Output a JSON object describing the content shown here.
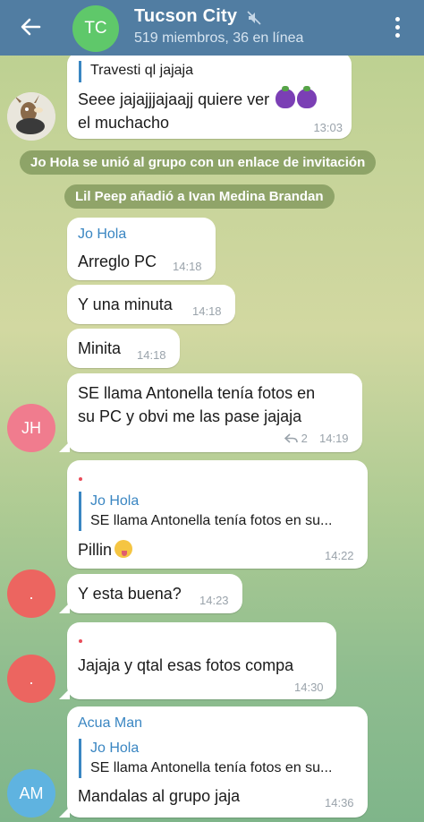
{
  "header": {
    "title": "Tucson City",
    "subtitle": "519 miembros, 36 en línea",
    "avatar_initials": "TC",
    "avatar_color": "#5fc86a",
    "bar_color": "#517da2"
  },
  "messages": {
    "m1": {
      "reply_text": "Travesti ql jajaja",
      "line1": "Seee jajajjjajaajj quiere ver",
      "line2": "el muchacho",
      "time": "13:03"
    },
    "sys1": "Jo Hola se unió al grupo con un enlace de invitación",
    "sys2": "Lil Peep añadió a Ivan Medina Brandan",
    "m2": {
      "sender": "Jo Hola",
      "text": "Arreglo PC",
      "time": "14:18"
    },
    "m3": {
      "text": "Y una minuta",
      "time": "14:18"
    },
    "m4": {
      "text": "Minita",
      "time": "14:18"
    },
    "m5": {
      "line1": "SE llama Antonella tenía fotos en",
      "line2": "su PC  y obvi me las pase jajaja",
      "reply_count": "2",
      "time": "14:19",
      "avatar": "JH"
    },
    "m6": {
      "reply_name": "Jo Hola",
      "reply_text": "SE llama Antonella tenía fotos en su...",
      "text": "Pillin",
      "time": "14:22"
    },
    "m7": {
      "text": "Y esta buena?",
      "time": "14:23",
      "avatar": "."
    },
    "m8": {
      "text": "Jajaja y qtal esas fotos compa",
      "time": "14:30"
    },
    "m9": {
      "sender": "Acua Man",
      "reply_name": "Jo Hola",
      "reply_text": "SE llama Antonella tenía fotos en su...",
      "text": "Mandalas al grupo jaja",
      "time": "14:36",
      "avatar": "AM"
    }
  },
  "colors": {
    "jh_avatar": "#f07c8e",
    "dot_avatar": "#ec6560",
    "am_avatar": "#5fb3e0",
    "accent": "#3a86c2"
  }
}
